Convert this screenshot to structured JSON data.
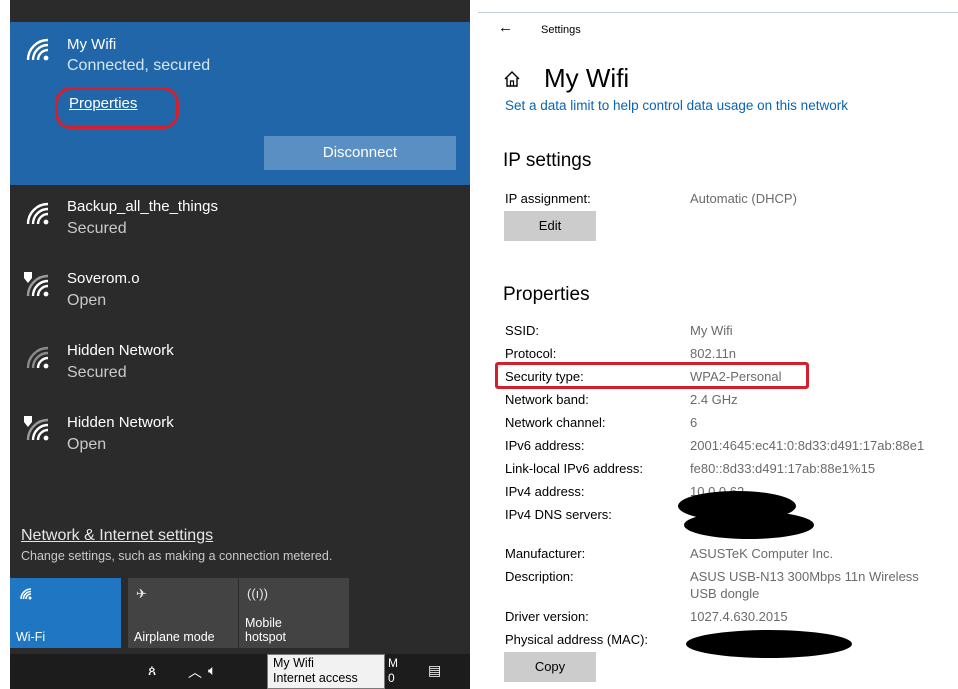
{
  "flyout": {
    "active_network": {
      "name": "My Wifi",
      "status": "Connected, secured",
      "properties_link": "Properties",
      "disconnect_label": "Disconnect"
    },
    "networks": [
      {
        "name": "Backup_all_the_things",
        "status": "Secured",
        "icon": "wifi-icon"
      },
      {
        "name": "Soverom.o",
        "status": "Open",
        "icon": "wifi-shield-icon"
      },
      {
        "name": "Hidden Network",
        "status": "Secured",
        "icon": "wifi-icon"
      },
      {
        "name": "Hidden Network",
        "status": "Open",
        "icon": "wifi-shield-icon"
      }
    ],
    "settings_link": "Network & Internet settings",
    "settings_desc": "Change settings, such as making a connection metered.",
    "quick_actions": [
      {
        "label": "Wi-Fi",
        "icon": "wifi-icon",
        "active": true
      },
      {
        "label": "Airplane mode",
        "icon": "airplane-icon",
        "active": false
      },
      {
        "label_line1": "Mobile",
        "label_line2": "hotspot",
        "icon": "hotspot-icon",
        "active": false
      }
    ],
    "tooltip": {
      "line1": "My Wifi",
      "line2": "Internet access"
    },
    "clock_fragment": {
      "line1": "M",
      "line2": "0"
    }
  },
  "settings": {
    "window_title": "Settings",
    "page_title": "My Wifi",
    "data_limit_link": "Set a data limit to help control data usage on this network",
    "ip_settings": {
      "heading": "IP settings",
      "assignment_label": "IP assignment:",
      "assignment_value": "Automatic (DHCP)",
      "edit_label": "Edit"
    },
    "properties": {
      "heading": "Properties",
      "rows": [
        {
          "label": "SSID:",
          "value": "My Wifi"
        },
        {
          "label": "Protocol:",
          "value": "802.11n"
        },
        {
          "label": "Security type:",
          "value": "WPA2-Personal"
        },
        {
          "label": "Network band:",
          "value": "2.4 GHz"
        },
        {
          "label": "Network channel:",
          "value": "6"
        },
        {
          "label": "IPv6 address:",
          "value": "2001:4645:ec41:0:8d33:d491:17ab:88e1"
        },
        {
          "label": "Link-local IPv6 address:",
          "value": "fe80::8d33:d491:17ab:88e1%15"
        },
        {
          "label": "IPv4 address:",
          "value": "10.0.0.62"
        },
        {
          "label": "IPv4 DNS servers:",
          "value": ""
        },
        {
          "label": "Manufacturer:",
          "value": "ASUSTeK Computer Inc."
        },
        {
          "label": "Description:",
          "value": "ASUS USB-N13 300Mbps 11n Wireless",
          "value2": "USB dongle"
        },
        {
          "label": "Driver version:",
          "value": "1027.4.630.2015"
        },
        {
          "label": "Physical address (MAC):",
          "value": ""
        }
      ],
      "copy_label": "Copy"
    }
  },
  "colors": {
    "flyout_bg": "#2b2b2b",
    "active_bg": "#2066a8",
    "accent_tile": "#1f77c4",
    "highlight_red": "#d3202f",
    "link_blue": "#0a64b4"
  }
}
